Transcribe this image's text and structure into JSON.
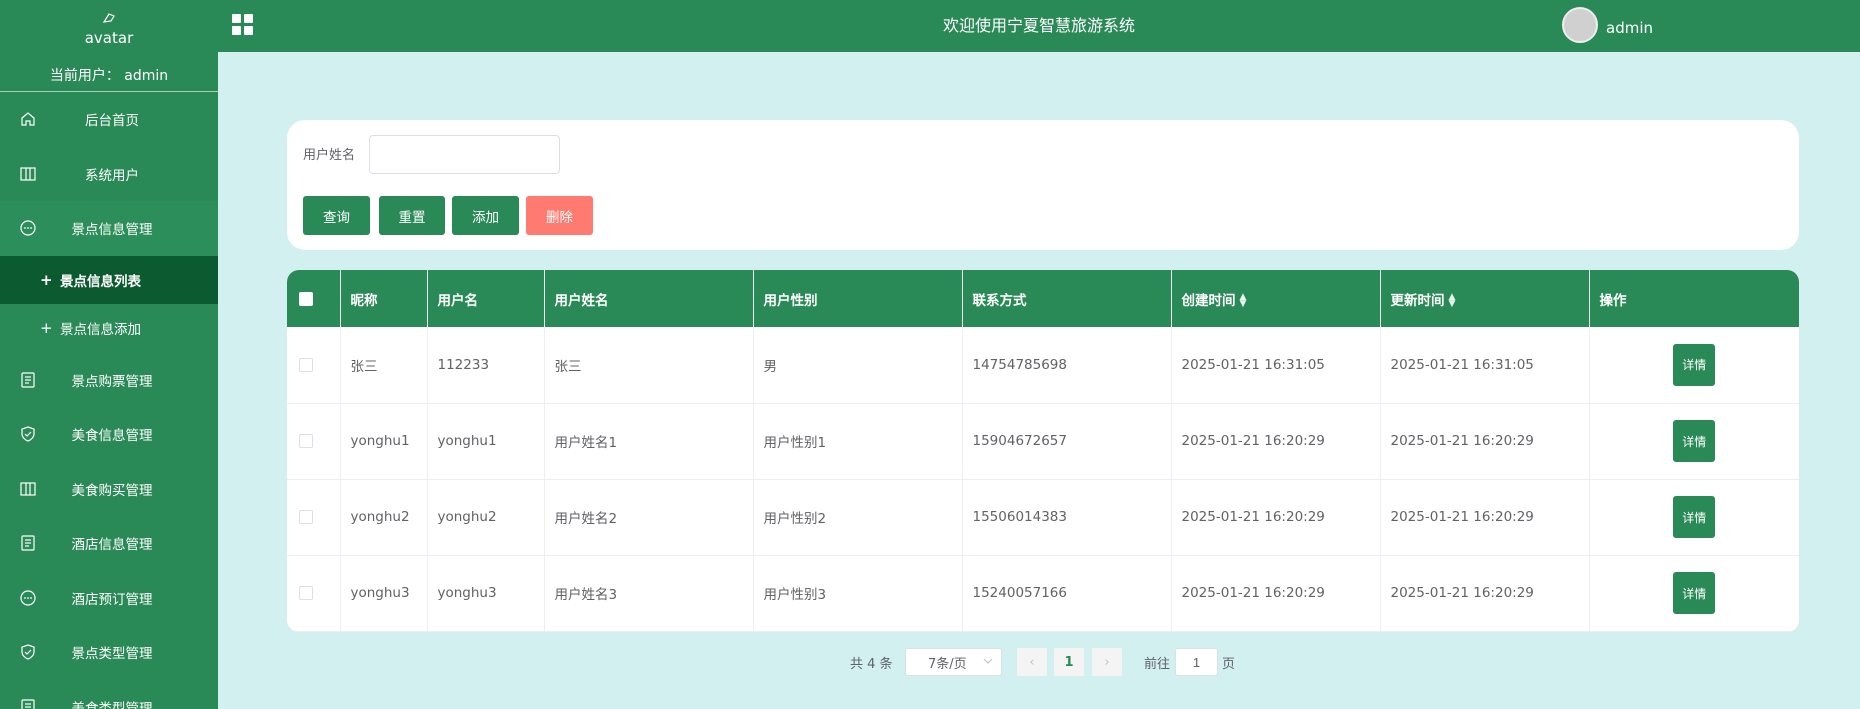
{
  "sidebar": {
    "avatar_alt": "avatar",
    "current_user": "当前用户： admin",
    "items": [
      {
        "label": "后台首页",
        "icon": "home-icon"
      },
      {
        "label": "系统用户",
        "icon": "columns-icon"
      },
      {
        "label": "景点信息管理",
        "icon": "chat-icon"
      },
      {
        "label": "景点信息管理",
        "icon": "document-icon"
      },
      {
        "label": "美食信息管理",
        "icon": "shield-check-icon"
      },
      {
        "label": "美食购买管理",
        "icon": "columns-icon"
      },
      {
        "label": "酒店信息管理",
        "icon": "document-icon"
      },
      {
        "label": "酒店预订管理",
        "icon": "chat-icon"
      },
      {
        "label": "景点类型管理",
        "icon": "shield-check-icon"
      },
      {
        "label": "美食类型管理",
        "icon": "document-icon"
      }
    ],
    "sub_items": [
      {
        "label": "景点信息列表",
        "active": true
      },
      {
        "label": "景点信息添加",
        "active": false
      }
    ],
    "items_fixed": {
      "ticket": "景点购票管理"
    }
  },
  "header": {
    "title": "欢迎使用宁夏智慧旅游系统",
    "username": "admin"
  },
  "search": {
    "label": "用户姓名",
    "value": "",
    "placeholder": "",
    "buttons": {
      "query": "查询",
      "reset": "重置",
      "add": "添加",
      "delete": "删除"
    }
  },
  "table": {
    "columns": [
      "昵称",
      "用户名",
      "用户姓名",
      "用户性别",
      "联系方式",
      "创建时间",
      "更新时间",
      "操作"
    ],
    "rows": [
      [
        "张三",
        "112233",
        "张三",
        "男",
        "14754785698",
        "2025-01-21 16:31:05",
        "2025-01-21 16:31:05"
      ],
      [
        "yonghu1",
        "yonghu1",
        "用户姓名1",
        "用户性别1",
        "15904672657",
        "2025-01-21 16:20:29",
        "2025-01-21 16:20:29"
      ],
      [
        "yonghu2",
        "yonghu2",
        "用户姓名2",
        "用户性别2",
        "15506014383",
        "2025-01-21 16:20:29",
        "2025-01-21 16:20:29"
      ],
      [
        "yonghu3",
        "yonghu3",
        "用户姓名3",
        "用户性别3",
        "15240057166",
        "2025-01-21 16:20:29",
        "2025-01-21 16:20:29"
      ]
    ],
    "detail_label": "详情"
  },
  "pagination": {
    "total": "共 4 条",
    "page_size": "7条/页",
    "current_page": "1",
    "goto_label": "前往",
    "goto_value": "1",
    "page_unit": "页"
  },
  "colors": {
    "primary": "#2a8a57",
    "active_sub": "#0c5a30",
    "danger": "#ff7b72",
    "background": "#d2f0f0"
  }
}
